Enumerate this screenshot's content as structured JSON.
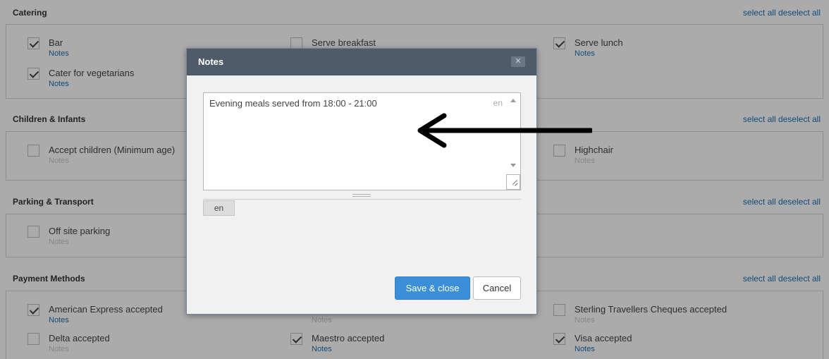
{
  "sections": [
    {
      "title": "Catering",
      "select_all": "select all",
      "deselect_all": "deselect all",
      "options": [
        {
          "label": "Bar",
          "notes": "Notes",
          "checked": true
        },
        {
          "label": "Serve breakfast",
          "notes": "",
          "checked": false
        },
        {
          "label": "Serve lunch",
          "notes": "Notes",
          "checked": true
        },
        {
          "label": "Cater for vegetarians",
          "notes": "Notes",
          "checked": true
        }
      ]
    },
    {
      "title": "Children & Infants",
      "select_all": "select all",
      "deselect_all": "deselect all",
      "options": [
        {
          "label": "Accept children (Minimum age)",
          "notes": "Notes",
          "checked": false
        },
        {
          "label": "Highchair",
          "notes": "Notes",
          "checked": false
        }
      ]
    },
    {
      "title": "Parking & Transport",
      "select_all": "select all",
      "deselect_all": "deselect all",
      "options": [
        {
          "label": "Off site parking",
          "notes": "Notes",
          "checked": false
        }
      ]
    },
    {
      "title": "Payment Methods",
      "select_all": "select all",
      "deselect_all": "deselect all",
      "options": [
        {
          "label": "American Express accepted",
          "notes": "Notes",
          "checked": true
        },
        {
          "label": "",
          "notes": "Notes",
          "checked": false
        },
        {
          "label": "Sterling Travellers Cheques accepted",
          "notes": "Notes",
          "checked": false
        },
        {
          "label": "Delta accepted",
          "notes": "Notes",
          "checked": false
        },
        {
          "label": "Maestro accepted",
          "notes": "Notes",
          "checked": true
        },
        {
          "label": "Visa accepted",
          "notes": "Notes",
          "checked": true
        }
      ]
    }
  ],
  "dialog": {
    "title": "Notes",
    "close_label": "✕",
    "text": "Evening meals served from 18:00 - 21:00",
    "lang_indicator": "en",
    "lang_tab": "en",
    "save_label": "Save & close",
    "cancel_label": "Cancel"
  },
  "colors": {
    "link": "#1c6fb5",
    "dialog_header": "#4f5b69",
    "save_button": "#3a8fd8"
  }
}
